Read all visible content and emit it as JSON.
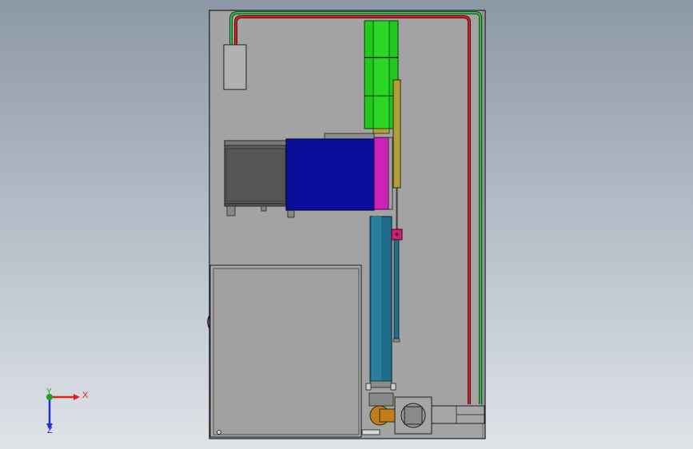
{
  "triad": {
    "x_label": "X",
    "y_label": "Y",
    "z_label": "Z"
  },
  "colors": {
    "viewport_top": "#8d98a7",
    "viewport_bottom": "#dfe3e8",
    "plate": "#a3a3a3",
    "outline": "#1f1f1f",
    "wire_red": "#d42020",
    "wire_green": "#33b84a",
    "green_cylinder": "#22c81e",
    "blue_block": "#0a0f9a",
    "magenta_guide": "#cc22b8",
    "olive_rod": "#b3a035",
    "blue_cylinder": "#1f6d8a",
    "bronze_part": "#c07e1a",
    "axis_x": "#e02020",
    "axis_y": "#20a020",
    "axis_z": "#2030d0"
  }
}
